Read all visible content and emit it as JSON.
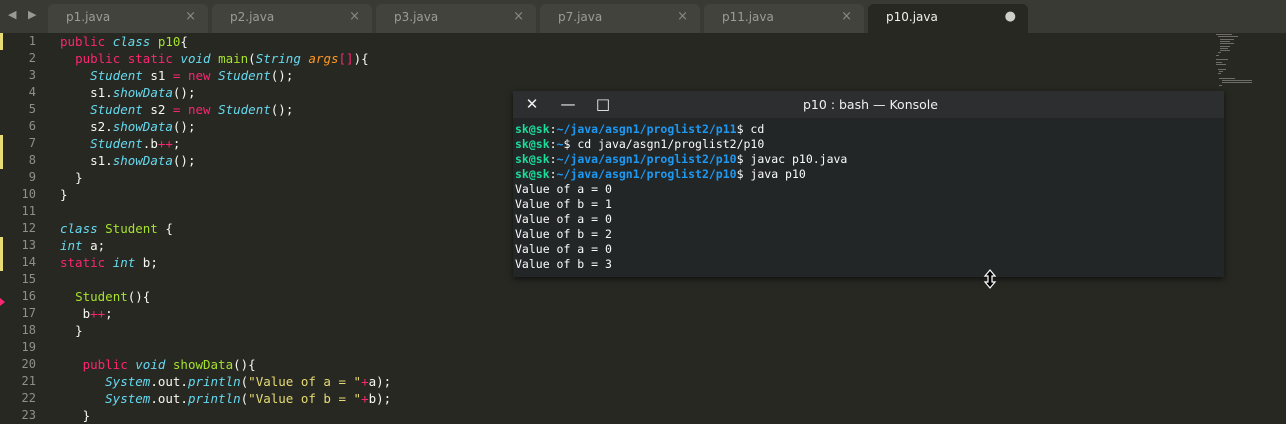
{
  "tabs": [
    {
      "label": "p1.java",
      "close": "×"
    },
    {
      "label": "p2.java",
      "close": "×"
    },
    {
      "label": "p3.java",
      "close": "×"
    },
    {
      "label": "p7.java",
      "close": "×"
    },
    {
      "label": "p11.java",
      "close": "×"
    },
    {
      "label": "p10.java",
      "close": "●"
    }
  ],
  "nav": {
    "arrows": "◀ ▶"
  },
  "editor": {
    "line_numbers": [
      "1",
      "2",
      "3",
      "4",
      "5",
      "6",
      "7",
      "8",
      "9",
      "10",
      "11",
      "12",
      "13",
      "14",
      "15",
      "16",
      "17",
      "18",
      "19",
      "20",
      "21",
      "22",
      "23"
    ],
    "lines": [
      {
        "indent": "",
        "tokens": [
          {
            "c": "k",
            "t": "public "
          },
          {
            "c": "t",
            "t": "class "
          },
          {
            "c": "c",
            "t": "p10"
          },
          {
            "c": "",
            "t": "{"
          }
        ]
      },
      {
        "indent": "  ",
        "tokens": [
          {
            "c": "k",
            "t": "public static "
          },
          {
            "c": "t",
            "t": "void "
          },
          {
            "c": "f",
            "t": "main"
          },
          {
            "c": "",
            "t": "("
          },
          {
            "c": "t",
            "t": "String "
          },
          {
            "c": "a",
            "t": "args"
          },
          {
            "c": "o",
            "t": "[]"
          },
          {
            "c": "",
            "t": "){"
          }
        ]
      },
      {
        "indent": "    ",
        "tokens": [
          {
            "c": "t",
            "t": "Student "
          },
          {
            "c": "",
            "t": "s1 "
          },
          {
            "c": "o",
            "t": "= "
          },
          {
            "c": "k",
            "t": "new "
          },
          {
            "c": "t",
            "t": "Student"
          },
          {
            "c": "",
            "t": "();"
          }
        ]
      },
      {
        "indent": "    ",
        "tokens": [
          {
            "c": "",
            "t": "s1."
          },
          {
            "c": "t",
            "t": "showData"
          },
          {
            "c": "",
            "t": "();"
          }
        ]
      },
      {
        "indent": "    ",
        "tokens": [
          {
            "c": "t",
            "t": "Student "
          },
          {
            "c": "",
            "t": "s2 "
          },
          {
            "c": "o",
            "t": "= "
          },
          {
            "c": "k",
            "t": "new "
          },
          {
            "c": "t",
            "t": "Student"
          },
          {
            "c": "",
            "t": "();"
          }
        ]
      },
      {
        "indent": "    ",
        "tokens": [
          {
            "c": "",
            "t": "s2."
          },
          {
            "c": "t",
            "t": "showData"
          },
          {
            "c": "",
            "t": "();"
          }
        ]
      },
      {
        "indent": "    ",
        "tokens": [
          {
            "c": "t",
            "t": "Student"
          },
          {
            "c": "",
            "t": ".b"
          },
          {
            "c": "o",
            "t": "++"
          },
          {
            "c": "",
            "t": ";"
          }
        ]
      },
      {
        "indent": "    ",
        "tokens": [
          {
            "c": "",
            "t": "s1."
          },
          {
            "c": "t",
            "t": "showData"
          },
          {
            "c": "",
            "t": "();"
          }
        ]
      },
      {
        "indent": "  ",
        "tokens": [
          {
            "c": "",
            "t": "}"
          }
        ]
      },
      {
        "indent": "",
        "tokens": [
          {
            "c": "",
            "t": "}"
          }
        ]
      },
      {
        "indent": "",
        "tokens": []
      },
      {
        "indent": "",
        "tokens": [
          {
            "c": "t",
            "t": "class "
          },
          {
            "c": "c",
            "t": "Student "
          },
          {
            "c": "",
            "t": "{"
          }
        ]
      },
      {
        "indent": "",
        "tokens": [
          {
            "c": "t",
            "t": "int "
          },
          {
            "c": "",
            "t": "a;"
          }
        ]
      },
      {
        "indent": "",
        "tokens": [
          {
            "c": "k",
            "t": "static "
          },
          {
            "c": "t",
            "t": "int "
          },
          {
            "c": "",
            "t": "b;"
          }
        ]
      },
      {
        "indent": "",
        "tokens": []
      },
      {
        "indent": "  ",
        "tokens": [
          {
            "c": "f",
            "t": "Student"
          },
          {
            "c": "",
            "t": "(){"
          }
        ]
      },
      {
        "indent": "   ",
        "tokens": [
          {
            "c": "",
            "t": "b"
          },
          {
            "c": "o",
            "t": "++"
          },
          {
            "c": "",
            "t": ";"
          }
        ]
      },
      {
        "indent": "  ",
        "tokens": [
          {
            "c": "",
            "t": "}"
          }
        ]
      },
      {
        "indent": "",
        "tokens": []
      },
      {
        "indent": "   ",
        "tokens": [
          {
            "c": "k",
            "t": "public "
          },
          {
            "c": "t",
            "t": "void "
          },
          {
            "c": "f",
            "t": "showData"
          },
          {
            "c": "",
            "t": "(){"
          }
        ]
      },
      {
        "indent": "      ",
        "tokens": [
          {
            "c": "t",
            "t": "System"
          },
          {
            "c": "",
            "t": ".out."
          },
          {
            "c": "t",
            "t": "println"
          },
          {
            "c": "",
            "t": "("
          },
          {
            "c": "s",
            "t": "\"Value of a = \""
          },
          {
            "c": "o",
            "t": "+"
          },
          {
            "c": "",
            "t": "a);"
          }
        ]
      },
      {
        "indent": "      ",
        "tokens": [
          {
            "c": "t",
            "t": "System"
          },
          {
            "c": "",
            "t": ".out."
          },
          {
            "c": "t",
            "t": "println"
          },
          {
            "c": "",
            "t": "("
          },
          {
            "c": "s",
            "t": "\"Value of b = \""
          },
          {
            "c": "o",
            "t": "+"
          },
          {
            "c": "",
            "t": "b);"
          }
        ]
      },
      {
        "indent": "   ",
        "tokens": [
          {
            "c": "",
            "t": "}"
          }
        ]
      }
    ],
    "modified_lines": [
      1,
      7,
      8,
      13,
      14
    ],
    "error_line": 16
  },
  "konsole": {
    "title": "p10 : bash — Konsole",
    "close_icon": "✕",
    "minimize_icon": "—",
    "maximize_icon": "□",
    "lines": [
      {
        "user": "sk@sk",
        "sep": ":",
        "path": "~/java/asgn1/proglist2/p11",
        "cmd": "$ cd"
      },
      {
        "user": "sk@sk",
        "sep": ":",
        "path": "~",
        "cmd": "$ cd java/asgn1/proglist2/p10"
      },
      {
        "user": "sk@sk",
        "sep": ":",
        "path": "~/java/asgn1/proglist2/p10",
        "cmd": "$ javac p10.java"
      },
      {
        "user": "sk@sk",
        "sep": ":",
        "path": "~/java/asgn1/proglist2/p10",
        "cmd": "$ java p10"
      },
      {
        "output": "Value of a = 0"
      },
      {
        "output": "Value of b = 1"
      },
      {
        "output": "Value of a = 0"
      },
      {
        "output": "Value of b = 2"
      },
      {
        "output": "Value of a = 0"
      },
      {
        "output": "Value of b = 3"
      }
    ]
  },
  "colors": {
    "editor_bg": "#272822",
    "keyword": "#f92672",
    "type": "#66d9ef",
    "class_name": "#a6e22e",
    "string": "#e6db74",
    "konsole_bg": "#232627",
    "prompt_user": "#1cdc9a",
    "prompt_path": "#1d99f3"
  },
  "cursor": {
    "icon": "resize-vertical-icon"
  }
}
